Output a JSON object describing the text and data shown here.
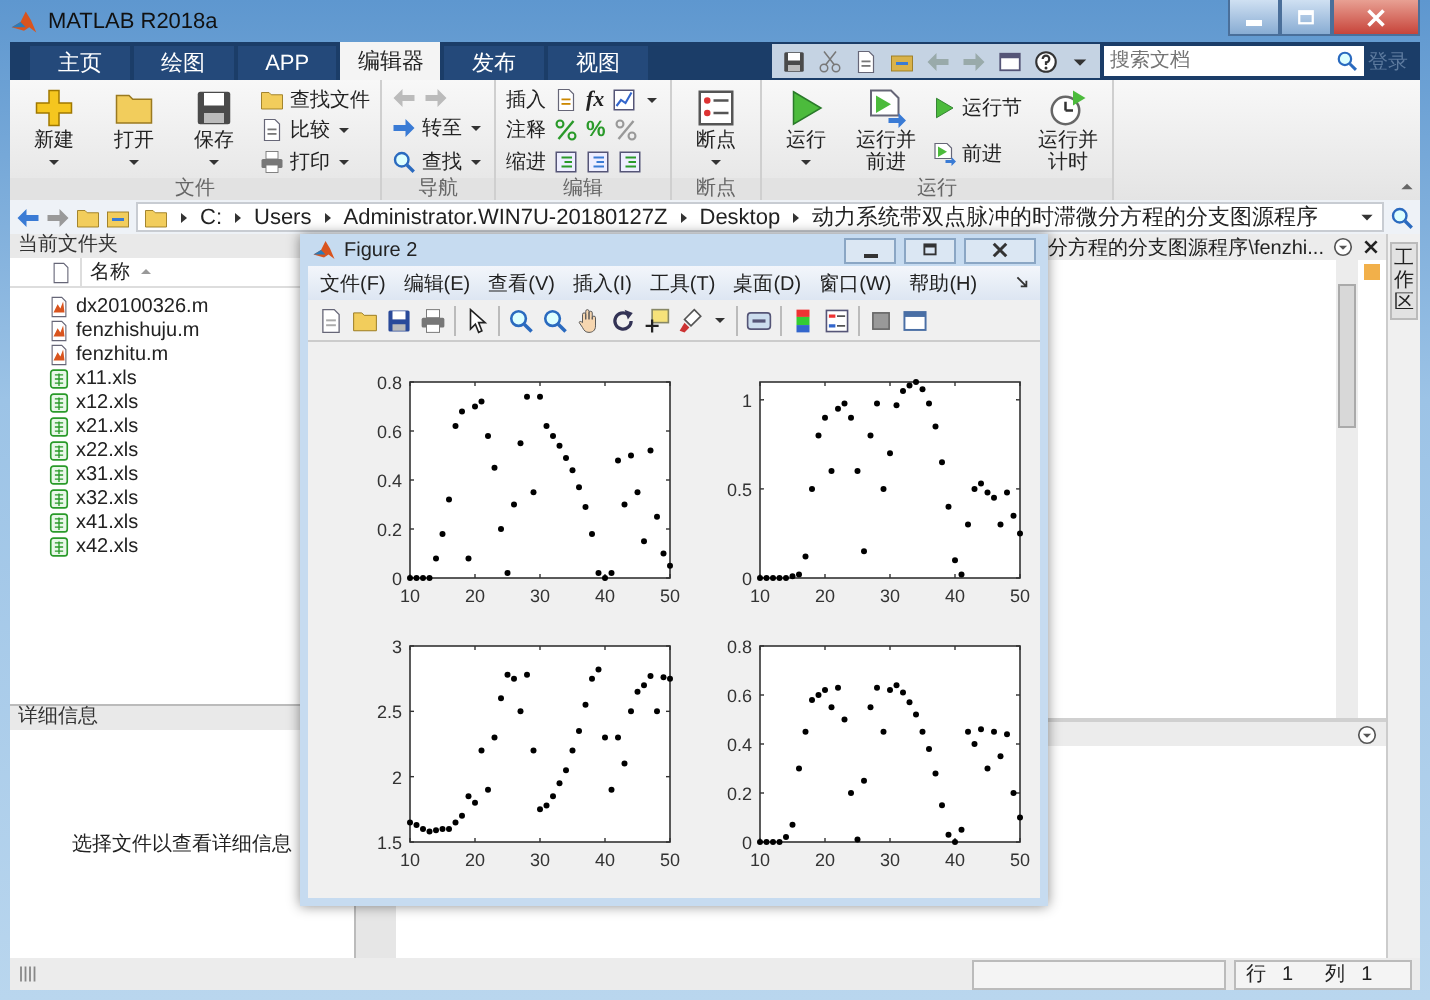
{
  "window": {
    "title": "MATLAB R2018a"
  },
  "tabs": [
    {
      "label": "主页",
      "selected": false
    },
    {
      "label": "绘图",
      "selected": false
    },
    {
      "label": "APP",
      "selected": false
    },
    {
      "label": "编辑器",
      "selected": true
    },
    {
      "label": "发布",
      "selected": false
    },
    {
      "label": "视图",
      "selected": false
    }
  ],
  "search": {
    "placeholder": "搜索文档"
  },
  "login": {
    "label": "登录",
    "disabled": true
  },
  "ribbon": {
    "groups": [
      {
        "label": "文件",
        "columns": [
          {
            "kind": "large",
            "label": "新建",
            "caret": true
          },
          {
            "kind": "large",
            "label": "打开",
            "caret": true
          },
          {
            "kind": "large",
            "label": "保存",
            "caret": true
          },
          {
            "kind": "stack",
            "items": [
              {
                "label": "查找文件",
                "caret": false
              },
              {
                "label": "比较",
                "caret": true
              },
              {
                "label": "打印",
                "caret": true
              }
            ]
          }
        ]
      },
      {
        "label": "导航",
        "columns": [
          {
            "kind": "nav",
            "items": [
              {
                "label": "转至",
                "caret": true
              },
              {
                "label": "查找",
                "caret": true
              }
            ]
          }
        ]
      },
      {
        "label": "编辑",
        "columns": [
          {
            "kind": "edit",
            "rows": [
              {
                "label": "插入",
                "symbol": "fx",
                "caret": true
              },
              {
                "label": "注释",
                "symbol": "%",
                "caret": false
              },
              {
                "label": "缩进",
                "caret": false
              }
            ]
          }
        ]
      },
      {
        "label": "断点",
        "columns": [
          {
            "kind": "large",
            "label": "断点",
            "caret": true
          }
        ]
      },
      {
        "label": "运行",
        "columns": [
          {
            "kind": "large",
            "label": "运行",
            "caret": true
          },
          {
            "kind": "large",
            "label": "运行并前进",
            "caret": false
          },
          {
            "kind": "stack",
            "items": [
              {
                "label": "运行节",
                "caret": false
              },
              {
                "label": "前进",
                "caret": false
              }
            ]
          },
          {
            "kind": "large",
            "label": "运行并计时",
            "caret": false
          }
        ]
      }
    ]
  },
  "address_bar": {
    "segments": [
      "C:",
      "Users",
      "Administrator.WIN7U-20180127Z",
      "Desktop",
      "动力系统带双点脉冲的时滞微分方程的分支图源程序"
    ]
  },
  "current_folder": {
    "title": "当前文件夹",
    "column": "名称",
    "files": [
      {
        "name": "dx20100326.m",
        "kind": "m"
      },
      {
        "name": "fenzhishuju.m",
        "kind": "m"
      },
      {
        "name": "fenzhitu.m",
        "kind": "m"
      },
      {
        "name": "x11.xls",
        "kind": "xls"
      },
      {
        "name": "x12.xls",
        "kind": "xls"
      },
      {
        "name": "x21.xls",
        "kind": "xls"
      },
      {
        "name": "x22.xls",
        "kind": "xls"
      },
      {
        "name": "x31.xls",
        "kind": "xls"
      },
      {
        "name": "x32.xls",
        "kind": "xls"
      },
      {
        "name": "x41.xls",
        "kind": "xls"
      },
      {
        "name": "x42.xls",
        "kind": "xls"
      }
    ]
  },
  "details": {
    "title": "详细信息",
    "message": "选择文件以查看详细信息"
  },
  "editor": {
    "tab_title": "分方程的分支图源程序\\fenzhi..."
  },
  "workspace": {
    "label": "工作区"
  },
  "status_bar": {
    "row_label": "行",
    "row": "1",
    "col_label": "列",
    "col": "1"
  },
  "figure": {
    "title": "Figure 2",
    "menu": [
      "文件(F)",
      "编辑(E)",
      "查看(V)",
      "插入(I)",
      "工具(T)",
      "桌面(D)",
      "窗口(W)",
      "帮助(H)"
    ],
    "charts": [
      {
        "chart_data": {
          "type": "scatter",
          "xlim": [
            10,
            50
          ],
          "ylim": [
            0,
            0.8
          ],
          "xticks": [
            10,
            20,
            30,
            40,
            50
          ],
          "yticks": [
            0,
            0.2,
            0.4,
            0.6,
            0.8
          ],
          "x": [
            10,
            11,
            12,
            13,
            14,
            15,
            16,
            17,
            18,
            19,
            20,
            21,
            22,
            23,
            24,
            25,
            26,
            27,
            28,
            29,
            30,
            31,
            32,
            33,
            34,
            35,
            36,
            37,
            38,
            39,
            40,
            41,
            42,
            43,
            44,
            45,
            46,
            47,
            48,
            49,
            50
          ],
          "values": [
            0,
            0,
            0,
            0,
            0.08,
            0.18,
            0.32,
            0.62,
            0.68,
            0.08,
            0.7,
            0.72,
            0.58,
            0.45,
            0.2,
            0.02,
            0.3,
            0.55,
            0.74,
            0.35,
            0.74,
            0.62,
            0.58,
            0.54,
            0.49,
            0.44,
            0.37,
            0.29,
            0.18,
            0.02,
            0,
            0.02,
            0.48,
            0.3,
            0.5,
            0.35,
            0.15,
            0.52,
            0.25,
            0.1,
            0.05
          ]
        }
      },
      {
        "chart_data": {
          "type": "scatter",
          "xlim": [
            10,
            50
          ],
          "ylim": [
            0,
            1.1
          ],
          "xticks": [
            10,
            20,
            30,
            40,
            50
          ],
          "yticks": [
            0,
            0.5,
            1
          ],
          "x": [
            10,
            11,
            12,
            13,
            14,
            15,
            16,
            17,
            18,
            19,
            20,
            21,
            22,
            23,
            24,
            25,
            26,
            27,
            28,
            29,
            30,
            31,
            32,
            33,
            34,
            35,
            36,
            37,
            38,
            39,
            40,
            41,
            42,
            43,
            44,
            45,
            46,
            47,
            48,
            49,
            50
          ],
          "values": [
            0,
            0,
            0,
            0,
            0,
            0.01,
            0.02,
            0.12,
            0.5,
            0.8,
            0.9,
            0.6,
            0.95,
            0.98,
            0.9,
            0.6,
            0.15,
            0.8,
            0.98,
            0.5,
            0.7,
            0.97,
            1.05,
            1.08,
            1.1,
            1.06,
            0.98,
            0.85,
            0.65,
            0.4,
            0.1,
            0.02,
            0.3,
            0.5,
            0.53,
            0.48,
            0.45,
            0.3,
            0.48,
            0.35,
            0.25
          ]
        }
      },
      {
        "chart_data": {
          "type": "scatter",
          "xlim": [
            10,
            50
          ],
          "ylim": [
            1.5,
            3
          ],
          "xticks": [
            10,
            20,
            30,
            40,
            50
          ],
          "yticks": [
            1.5,
            2,
            2.5,
            3
          ],
          "x": [
            10,
            11,
            12,
            13,
            14,
            15,
            16,
            17,
            18,
            19,
            20,
            21,
            22,
            23,
            24,
            25,
            26,
            27,
            28,
            29,
            30,
            31,
            32,
            33,
            34,
            35,
            36,
            37,
            38,
            39,
            40,
            41,
            42,
            43,
            44,
            45,
            46,
            47,
            48,
            49,
            50
          ],
          "values": [
            1.65,
            1.63,
            1.6,
            1.58,
            1.59,
            1.6,
            1.6,
            1.65,
            1.7,
            1.85,
            1.8,
            2.2,
            1.9,
            2.3,
            2.6,
            2.78,
            2.75,
            2.5,
            2.78,
            2.2,
            1.75,
            1.78,
            1.85,
            1.95,
            2.05,
            2.2,
            2.35,
            2.55,
            2.75,
            2.82,
            2.3,
            1.9,
            2.3,
            2.1,
            2.5,
            2.65,
            2.7,
            2.77,
            2.5,
            2.76,
            2.75
          ]
        }
      },
      {
        "chart_data": {
          "type": "scatter",
          "xlim": [
            10,
            50
          ],
          "ylim": [
            0,
            0.8
          ],
          "xticks": [
            10,
            20,
            30,
            40,
            50
          ],
          "yticks": [
            0,
            0.2,
            0.4,
            0.6,
            0.8
          ],
          "x": [
            10,
            11,
            12,
            13,
            14,
            15,
            16,
            17,
            18,
            19,
            20,
            21,
            22,
            23,
            24,
            25,
            26,
            27,
            28,
            29,
            30,
            31,
            32,
            33,
            34,
            35,
            36,
            37,
            38,
            39,
            40,
            41,
            42,
            43,
            44,
            45,
            46,
            47,
            48,
            49,
            50
          ],
          "values": [
            0,
            0,
            0,
            0,
            0.02,
            0.07,
            0.3,
            0.45,
            0.58,
            0.6,
            0.62,
            0.55,
            0.63,
            0.5,
            0.2,
            0.01,
            0.25,
            0.55,
            0.63,
            0.45,
            0.62,
            0.64,
            0.61,
            0.57,
            0.52,
            0.45,
            0.38,
            0.28,
            0.15,
            0.03,
            0,
            0.05,
            0.45,
            0.4,
            0.46,
            0.3,
            0.45,
            0.35,
            0.44,
            0.2,
            0.1
          ]
        }
      }
    ]
  }
}
